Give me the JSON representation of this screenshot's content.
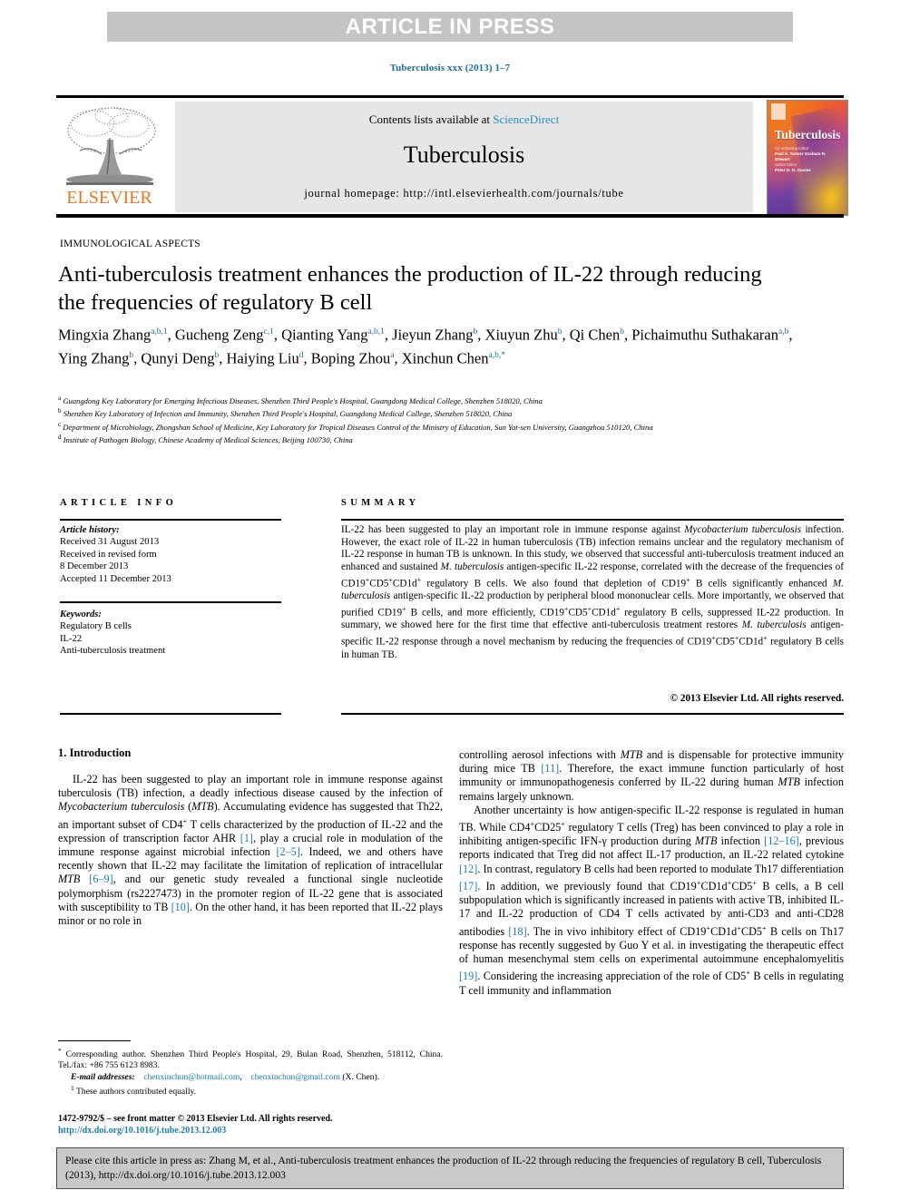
{
  "banner": {
    "text": "ARTICLE IN PRESS"
  },
  "running_head": "Tuberculosis xxx (2013) 1–7",
  "masthead": {
    "contents_prefix": "Contents lists available at ",
    "sciencedirect": "ScienceDirect",
    "journal_title": "Tuberculosis",
    "homepage": "journal homepage: http://intl.elsevierhealth.com/journals/tube",
    "publisher_logo_text": "ELSEVIER",
    "cover": {
      "title": "Tuberculosis",
      "editor_label": "Co-ordinating Editor",
      "editors": "Paul A. Tanner\nGraham R. Stewart",
      "senior_label": "Senior Editor",
      "senior": "Peter D. O. Davies"
    }
  },
  "article": {
    "section_label": "IMMUNOLOGICAL ASPECTS",
    "title": "Anti-tuberculosis treatment enhances the production of IL-22 through reducing the frequencies of regulatory B cell",
    "authors_html": "Mingxia Zhang<sup>a,b,1</sup>, Gucheng Zeng<sup>c,1</sup>, Qianting Yang<sup>a,b,1</sup>, Jieyun Zhang<sup>b</sup>, Xiuyun Zhu<sup>b</sup>, Qi Chen<sup>b</sup>, Pichaimuthu Suthakaran<sup>a,b</sup>, Ying Zhang<sup>b</sup>, Qunyi Deng<sup>b</sup>, Haiying Liu<sup>d</sup>, Boping Zhou<sup>a</sup>, Xinchun Chen<sup>a,b,*</sup>",
    "affiliations": [
      "<sup>a</sup> Guangdong Key Laboratory for Emerging Infectious Diseases, Shenzhen Third People's Hospital, Guangdong Medical College, Shenzhen 518020, China",
      "<sup>b</sup> Shenzhen Key Laboratory of Infection and Immunity, Shenzhen Third People's Hospital, Guangdong Medical College, Shenzhen 518020, China",
      "<sup>c</sup> Department of Microbiology, Zhongshan School of Medicine, Key Laboratory for Tropical Diseases Control of the Ministry of Education, Sun Yat-sen University, Guangzhou 510120, China",
      "<sup>d</sup> Institute of Pathogen Biology, Chinese Academy of Medical Sciences, Beijing 100730, China"
    ]
  },
  "info": {
    "heading": "ARTICLE INFO",
    "history_label": "Article history:",
    "history": [
      "Received 31 August 2013",
      "Received in revised form",
      "8 December 2013",
      "Accepted 11 December 2013"
    ],
    "keywords_label": "Keywords:",
    "keywords": [
      "Regulatory B cells",
      "IL-22",
      "Anti-tuberculosis treatment"
    ]
  },
  "summary": {
    "heading": "SUMMARY",
    "text_html": "IL-22 has been suggested to play an important role in immune response against <i>Mycobacterium tuberculosis</i> infection. However, the exact role of IL-22 in human tuberculosis (TB) infection remains unclear and the regulatory mechanism of IL-22 response in human TB is unknown. In this study, we observed that successful anti-tuberculosis treatment induced an enhanced and sustained <i>M. tuberculosis</i> antigen-specific IL-22 response, correlated with the decrease of the frequencies of CD19<sup>+</sup>CD5<sup>+</sup>CD1d<sup>+</sup> regulatory B cells. We also found that depletion of CD19<sup>+</sup> B cells significantly enhanced <i>M. tuberculosis</i> antigen-specific IL-22 production by peripheral blood mononuclear cells. More importantly, we observed that purified CD19<sup>+</sup> B cells, and more efficiently, CD19<sup>+</sup>CD5<sup>+</sup>CD1d<sup>+</sup> regulatory B cells, suppressed IL-22 production. In summary, we showed here for the first time that effective anti-tuberculosis treatment restores <i>M. tuberculosis</i> antigen-specific IL-22 response through a novel mechanism by reducing the frequencies of CD19<sup>+</sup>CD5<sup>+</sup>CD1d<sup>+</sup> regulatory B cells in human TB.",
    "copyright": "© 2013 Elsevier Ltd. All rights reserved."
  },
  "body": {
    "section_heading": "1. Introduction",
    "left_column_html": "<p>IL-22 has been suggested to play an important role in immune response against tuberculosis (TB) infection, a deadly infectious disease caused by the infection of <i>Mycobacterium tuberculosis</i> (<i>MTB</i>). Accumulating evidence has suggested that Th22, an important subset of CD4<sup>+</sup> T cells characterized by the production of IL-22 and the expression of transcription factor AHR <span class=\"ref\">[1]</span>, play a crucial role in modulation of the immune response against microbial infection <span class=\"ref\">[2–5]</span>. Indeed, we and others have recently shown that IL-22 may facilitate the limitation of replication of intracellular <i>MTB</i> <span class=\"ref\">[6–9]</span>, and our genetic study revealed a functional single nucleotide polymorphism (rs2227473) in the promoter region of IL-22 gene that is associated with susceptibility to TB <span class=\"ref\">[10]</span>. On the other hand, it has been reported that IL-22 plays minor or no role in</p>",
    "right_column_html": "<p class=\"noind\">controlling aerosol infections with <i>MTB</i> and is dispensable for protective immunity during mice TB <span class=\"ref\">[11]</span>. Therefore, the exact immune function particularly of host immunity or immunopathogenesis conferred by IL-22 during human <i>MTB</i> infection remains largely unknown.</p><p>Another uncertainty is how antigen-specific IL-22 response is regulated in human TB. While CD4<sup>+</sup>CD25<sup>+</sup> regulatory T cells (Treg) has been convinced to play a role in inhibiting antigen-specific IFN-γ production during <i>MTB</i> infection <span class=\"ref\">[12–16]</span>, previous reports indicated that Treg did not affect IL-17 production, an IL-22 related cytokine <span class=\"ref\">[12]</span>. In contrast, regulatory B cells had been reported to modulate Th17 differentiation <span class=\"ref\">[17]</span>. In addition, we previously found that CD19<sup>+</sup>CD1d<sup>+</sup>CD5<sup>+</sup> B cells, a B cell subpopulation which is significantly increased in patients with active TB, inhibited IL-17 and IL-22 production of CD4 T cells activated by anti-CD3 and anti-CD28 antibodies <span class=\"ref\">[18]</span>. The in vivo inhibitory effect of CD19<sup>+</sup>CD1d<sup>+</sup>CD5<sup>+</sup> B cells on Th17 response has recently suggested by Guo Y et al. in investigating the therapeutic effect of human mesenchymal stem cells on experimental autoimmune encephalomyelitis <span class=\"ref\">[19]</span>. Considering the increasing appreciation of the role of CD5<sup>+</sup> B cells in regulating T cell immunity and inflammation</p>"
  },
  "footnotes": {
    "corresponding_html": "<sup>*</sup> Corresponding author. Shenzhen Third People's Hospital, 29, Bulan Road, Shenzhen, 518112, China. Tel./fax: +86 755 6123 8983.",
    "email_label": "E-mail addresses:",
    "email1": "chenxinchun@hotmail.com",
    "email2": "chenxinchun@gmail.com",
    "email_owner": "(X. Chen).",
    "equal_contrib_html": "<sup>1</sup> These authors contributed equally."
  },
  "imprint": {
    "line1": "1472-9792/$ – see front matter © 2013 Elsevier Ltd. All rights reserved.",
    "doi": "http://dx.doi.org/10.1016/j.tube.2013.12.003"
  },
  "cite_box": {
    "text": "Please cite this article in press as: Zhang M, et al., Anti-tuberculosis treatment enhances the production of IL-22 through reducing the frequencies of regulatory B cell, Tuberculosis (2013), http://dx.doi.org/10.1016/j.tube.2013.12.003"
  },
  "colors": {
    "link_blue": "#1a7db5",
    "banner_gray": "#c4c4c4",
    "masthead_gray": "#e6e6e6",
    "elsevier_orange": "#E87722",
    "cite_box_gray": "#c9c9c9"
  }
}
